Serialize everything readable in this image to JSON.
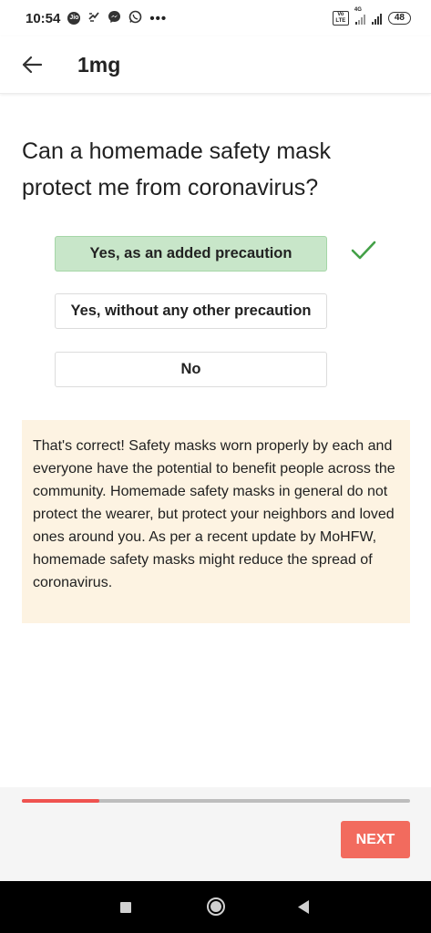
{
  "status_bar": {
    "time": "10:54",
    "icons": [
      "jio-icon",
      "data-saver-icon",
      "messenger-icon",
      "whatsapp-icon",
      "more-dots-icon"
    ],
    "more": "•••",
    "network": "4G",
    "volte": "Vo LTE",
    "battery": "48"
  },
  "app_bar": {
    "title": "1mg"
  },
  "quiz": {
    "question": "Can a homemade safety mask protect me from coronavirus?",
    "options": [
      {
        "label": "Yes, as an added precaution",
        "selected": true
      },
      {
        "label": "Yes, without any other precaution",
        "selected": false
      },
      {
        "label": "No",
        "selected": false
      }
    ],
    "feedback": "That's correct! Safety masks worn properly by each and everyone have the potential to benefit people across the community. Homemade safety masks in general do not protect the wearer, but protect your neighbors and loved ones around you. As per a recent update by MoHFW, homemade safety masks might reduce the spread of coronavirus."
  },
  "progress": {
    "fraction": 0.2
  },
  "footer": {
    "next_label": "NEXT"
  },
  "colors": {
    "accent": "#f26b5e",
    "progress": "#ef5350",
    "selected_bg": "#c8e6c9",
    "check": "#43a047",
    "feedback_bg": "#fdf3e2"
  },
  "nav": [
    "square-icon",
    "circle-icon",
    "triangle-back-icon"
  ]
}
